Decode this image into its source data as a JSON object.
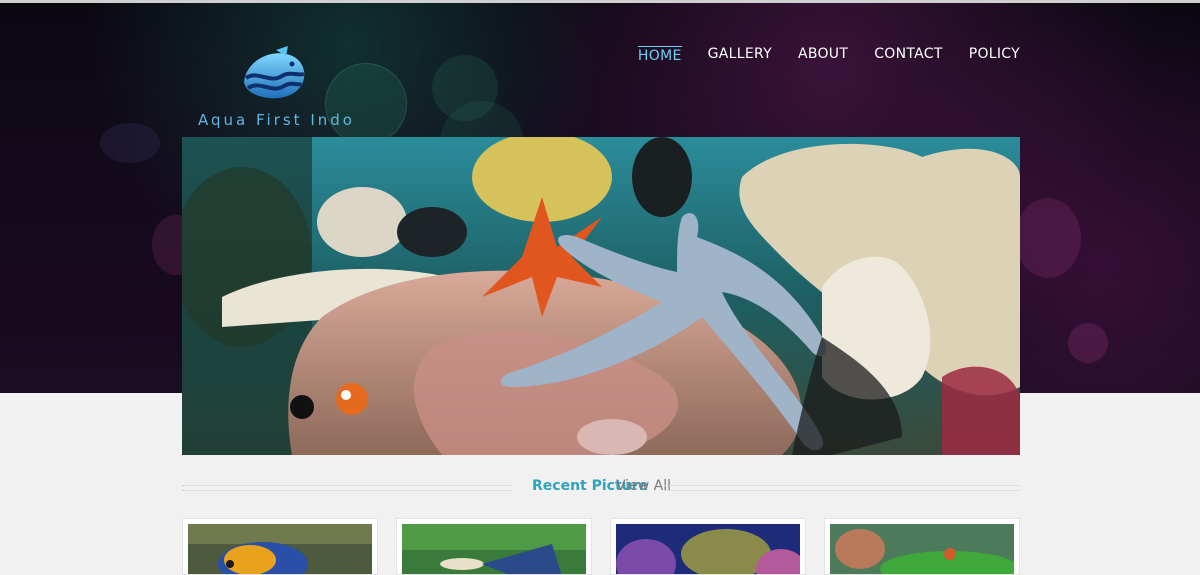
{
  "site": {
    "logo_text": "Aqua First Indo",
    "logo_icon": "fish-wave-icon",
    "accent": "#6ecff3",
    "title_color": "#2ea3bd"
  },
  "nav": {
    "items": [
      {
        "label": "HOME",
        "active": true
      },
      {
        "label": "GALLERY",
        "active": false
      },
      {
        "label": "ABOUT",
        "active": false
      },
      {
        "label": "CONTACT",
        "active": false
      },
      {
        "label": "POLICY",
        "active": false
      }
    ]
  },
  "banner": {
    "image": "underwater-reef-starfish"
  },
  "recent": {
    "title": "Recent Picture",
    "view_all": "View All"
  },
  "thumbnails": [
    {
      "image": "angelfish"
    },
    {
      "image": "guppy"
    },
    {
      "image": "coral-reef"
    },
    {
      "image": "planted-aquarium"
    }
  ]
}
